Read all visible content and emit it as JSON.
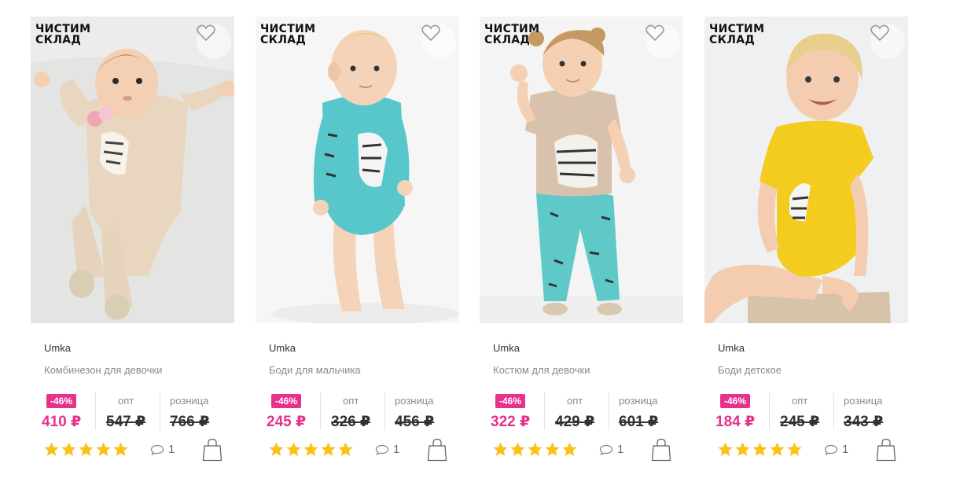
{
  "products": [
    {
      "sale_badge": "ЧИСТИМ\nСКЛАД",
      "brand": "Umka",
      "name": "Комбинезон для девочки",
      "discount": "-46%",
      "price_now": "410 ₽",
      "opt_label": "опт",
      "price_opt": "547 ₽",
      "retail_label": "розница",
      "price_retail": "766 ₽",
      "rating": 5,
      "reviews": "1",
      "photo": {
        "bg": "#ececec",
        "outfit": "#e8d6bf",
        "skin": "#f3cfb4",
        "hair": "#b88a5a"
      }
    },
    {
      "sale_badge": "ЧИСТИМ\nСКЛАД",
      "brand": "Umka",
      "name": "Боди для мальчика",
      "discount": "-46%",
      "price_now": "245 ₽",
      "opt_label": "опт",
      "price_opt": "326 ₽",
      "retail_label": "розница",
      "price_retail": "456 ₽",
      "rating": 5,
      "reviews": "1",
      "photo": {
        "bg": "#f6f6f6",
        "outfit": "#58c7cc",
        "skin": "#f5d3b8",
        "hair": "#e8c98a"
      }
    },
    {
      "sale_badge": "ЧИСТИМ\nСКЛАД",
      "brand": "Umka",
      "name": "Костюм для девочки",
      "discount": "-46%",
      "price_now": "322 ₽",
      "opt_label": "опт",
      "price_opt": "429 ₽",
      "retail_label": "розница",
      "price_retail": "601 ₽",
      "rating": 5,
      "reviews": "1",
      "photo": {
        "bg": "#f4f4f4",
        "outfit": "#d9c2ad",
        "pants": "#5fc9c8",
        "skin": "#f5d0b3",
        "hair": "#c49a62"
      }
    },
    {
      "sale_badge": "ЧИСТИМ\nСКЛАД",
      "brand": "Umka",
      "name": "Боди детское",
      "discount": "-46%",
      "price_now": "184 ₽",
      "opt_label": "опт",
      "price_opt": "245 ₽",
      "retail_label": "розница",
      "price_retail": "343 ₽",
      "rating": 5,
      "reviews": "1",
      "photo": {
        "bg": "#eef0f2",
        "outfit": "#f4cc1f",
        "skin": "#f4cdb0",
        "hair": "#e9cf8e"
      }
    }
  ],
  "colors": {
    "accent": "#e6328c",
    "star": "#f7c21a"
  },
  "icons": {
    "favorite": "heart-icon",
    "review": "comment-bubble-icon",
    "cart": "shopping-bag-icon",
    "rating": "star-icon"
  }
}
